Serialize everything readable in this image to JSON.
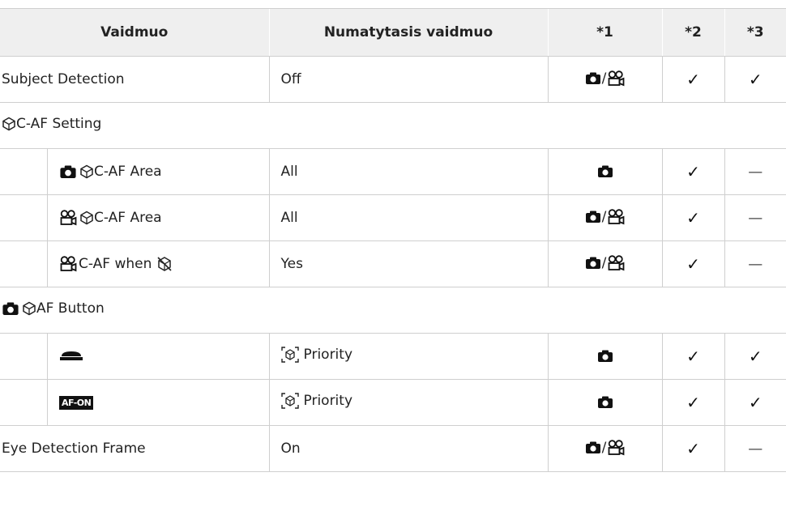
{
  "headers": [
    "Vaidmuo",
    "Numatytasis vaidmuo",
    "*1",
    "*2",
    "*3"
  ],
  "rows": [
    {
      "name": "Subject Detection",
      "value": "Off",
      "mode": "photo-video",
      "c2": "✓",
      "c3": "✓"
    },
    {
      "group": "C-AF Setting"
    },
    {
      "name": "C-AF Area",
      "value": "All",
      "mode": "photo",
      "c2": "✓",
      "c3": "—"
    },
    {
      "name": "C-AF Area",
      "value": "All",
      "mode": "photo-video",
      "c2": "✓",
      "c3": "—"
    },
    {
      "name": "C-AF when",
      "value": "Yes",
      "mode": "photo-video",
      "c2": "✓",
      "c3": "—"
    },
    {
      "group": "AF Button"
    },
    {
      "name": "",
      "value": "Priority",
      "mode": "photo",
      "c2": "✓",
      "c3": "✓"
    },
    {
      "name": "AF-ON",
      "value": "Priority",
      "mode": "photo",
      "c2": "✓",
      "c3": "✓"
    },
    {
      "name": "Eye Detection Frame",
      "value": "On",
      "mode": "photo-video",
      "c2": "✓",
      "c3": "—"
    }
  ],
  "separator": "/",
  "icons": [
    "camera-icon",
    "movie-icon",
    "subject-detect-icon",
    "subject-detect-off-icon",
    "shutter-button-icon",
    "af-on-button-icon",
    "subject-frame-icon"
  ]
}
